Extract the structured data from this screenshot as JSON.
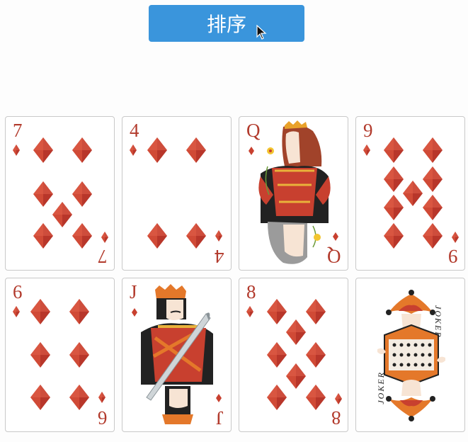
{
  "toolbar": {
    "sort_label": "排序"
  },
  "cards": [
    {
      "rank": "7",
      "suit": "diamonds"
    },
    {
      "rank": "4",
      "suit": "diamonds"
    },
    {
      "rank": "Q",
      "suit": "diamonds"
    },
    {
      "rank": "9",
      "suit": "diamonds"
    },
    {
      "rank": "6",
      "suit": "diamonds"
    },
    {
      "rank": "J",
      "suit": "diamonds"
    },
    {
      "rank": "8",
      "suit": "diamonds"
    },
    {
      "rank": "JOKER",
      "suit": "joker"
    }
  ],
  "colors": {
    "button": "#3a95dc",
    "suit_red": "#c8402f",
    "rank_text": "#b23a2c"
  }
}
